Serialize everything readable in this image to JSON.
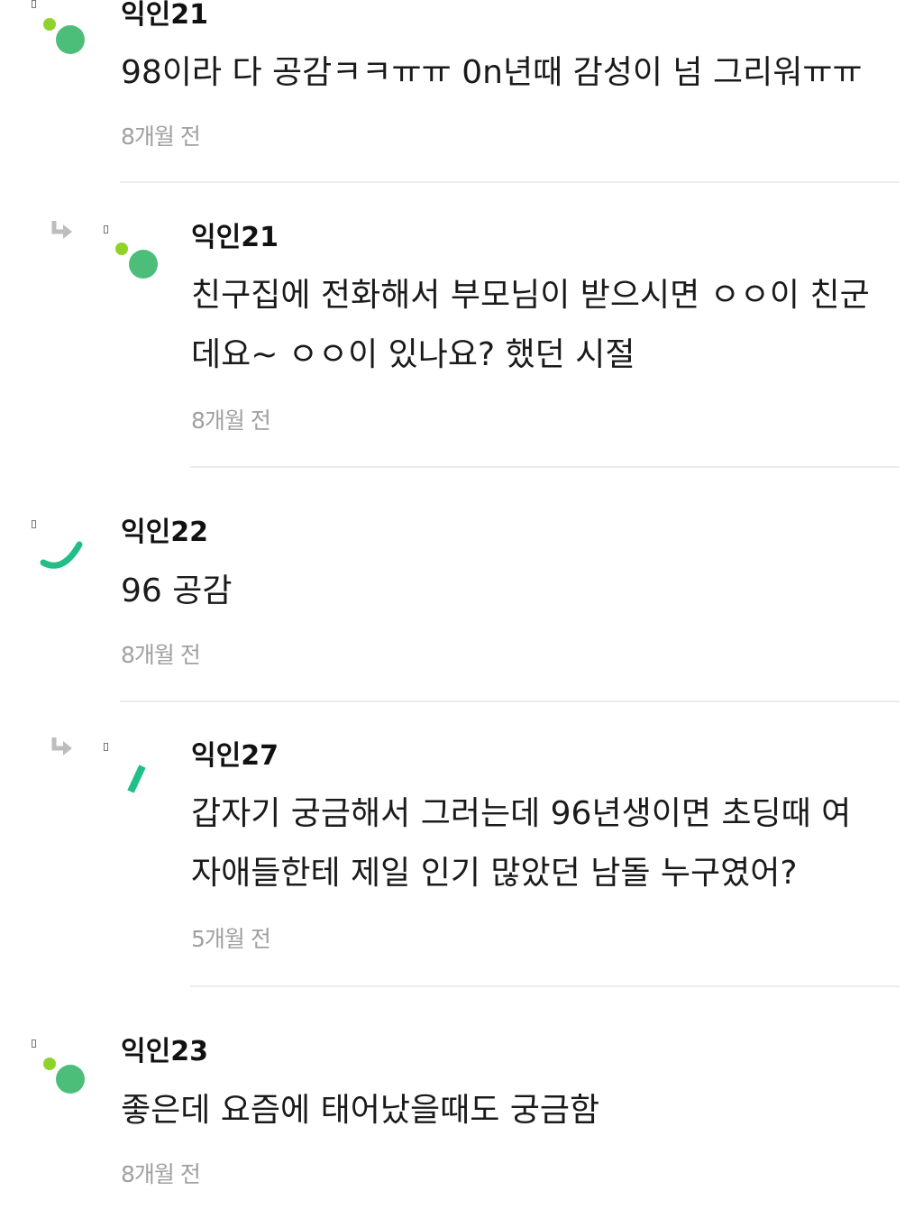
{
  "comments": [
    {
      "author": "익인21",
      "content": "98이라 다 공감ㅋㅋㅠㅠ 0n년때 감성이 넘 그리워ㅠㅠ",
      "time": "8개월 전",
      "is_reply": false,
      "avatar_icon": "dot-pair-avatar-icon"
    },
    {
      "author": "익인21",
      "content": "친구집에 전화해서 부모님이 받으시면 ㅇㅇ이 친군\n데요~ ㅇㅇ이 있나요? 했던 시절",
      "time": "8개월 전",
      "is_reply": true,
      "avatar_icon": "dot-pair-avatar-icon"
    },
    {
      "author": "익인22",
      "content": "96 공감",
      "time": "8개월 전",
      "is_reply": false,
      "avatar_icon": "arc-avatar-icon"
    },
    {
      "author": "익인27",
      "content": "갑자기 궁금해서 그러는데 96년생이면 초딩때 여\n자애들한테 제일 인기 많았던 남돌 누구였어?",
      "time": "5개월 전",
      "is_reply": true,
      "avatar_icon": "slash-avatar-icon"
    },
    {
      "author": "익인23",
      "content": "좋은데 요즘에 태어났을때도 궁금함",
      "time": "8개월 전",
      "is_reply": false,
      "avatar_icon": "dot-pair-avatar-icon"
    }
  ],
  "icons": {
    "reply_arrow": "reply-arrow-icon",
    "small_mark": "checkbox-mark-icon"
  },
  "colors": {
    "avatar_green": "#4cbe7a",
    "avatar_lime": "#8fd22c",
    "avatar_teal": "#1fbf85",
    "time_gray": "#a0a0a0",
    "divider": "#ececec"
  }
}
